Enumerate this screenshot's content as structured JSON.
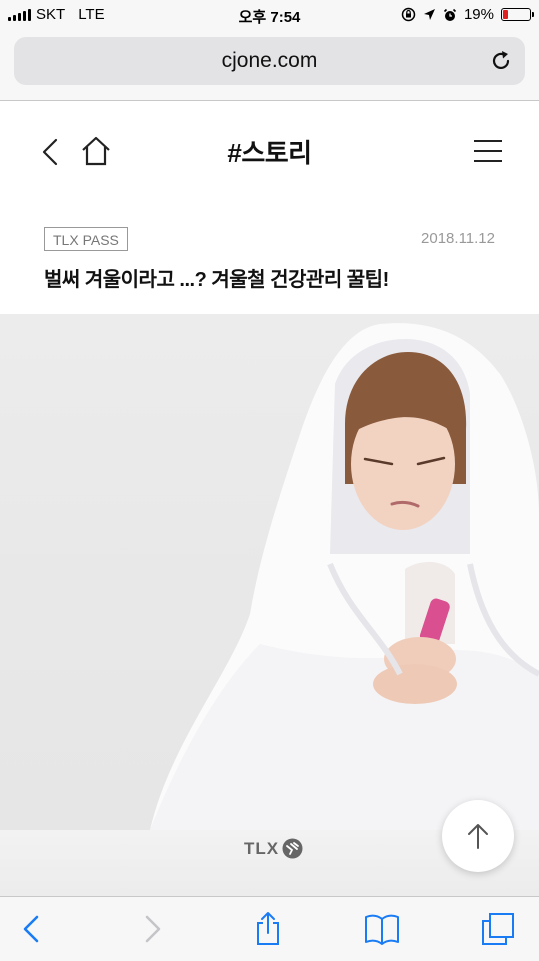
{
  "status_bar": {
    "carrier": "SKT",
    "network": "LTE",
    "time": "오후 7:54",
    "battery_percent": "19%",
    "battery_level": 0.19,
    "battery_color": "#e02020"
  },
  "browser": {
    "url": "cjone.com",
    "reload_icon": "reload-icon"
  },
  "header": {
    "title": "#스토리",
    "back_icon": "chevron-left-icon",
    "home_icon": "home-icon",
    "menu_icon": "hamburger-menu-icon"
  },
  "article": {
    "tag": "TLX PASS",
    "date": "2018.11.12",
    "headline": "벌써 겨울이라고 ...? 겨울철 건강관리 꿀팁!"
  },
  "hero": {
    "logo_text": "TLX"
  },
  "toolbar": {
    "back_icon": "chevron-left-icon",
    "forward_icon": "chevron-right-icon",
    "share_icon": "share-icon",
    "bookmarks_icon": "book-icon",
    "tabs_icon": "tabs-icon",
    "accent_color": "#1a7cf5"
  }
}
